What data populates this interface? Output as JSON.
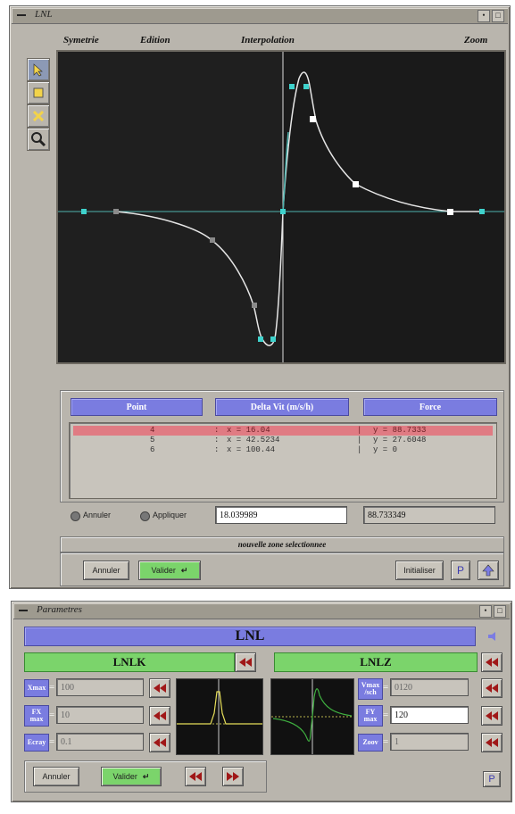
{
  "lnl_window": {
    "title": "LNL",
    "menu": [
      "Symetrie",
      "Edition",
      "Interpolation",
      "Zoom"
    ],
    "tools": [
      "pointer-icon",
      "add-point-icon",
      "delete-point-icon",
      "magnifier-icon"
    ],
    "table": {
      "headers": [
        "Point",
        "Delta Vit (m/s/h)",
        "Force"
      ],
      "rows": [
        {
          "point": "4",
          "x": "x = 16.04",
          "y": "y = 88.7333",
          "selected": true
        },
        {
          "point": "5",
          "x": "x = 42.5234",
          "y": "y = 27.6048",
          "selected": false
        },
        {
          "point": "6",
          "x": "x = 100.44",
          "y": "y = 0",
          "selected": false
        }
      ],
      "separator": ":",
      "separator2": "|"
    },
    "radio_annuler": "Annuler",
    "radio_appliquer": "Appliquer",
    "x_value": "18.039989",
    "y_value": "88.733349",
    "status": "nouvelle zone selectionnee",
    "btn_annuler": "Annuler",
    "btn_valider": "Valider",
    "btn_initialiser": "Initialiser",
    "btn_p": "P",
    "colors": {
      "curve": "#e6e6e6",
      "axis": "#4fb3ae",
      "point_cyan": "#3fd2cc",
      "point_white": "#ffffff",
      "point_gray": "#8a8a8a"
    }
  },
  "param_window": {
    "title": "Parametres",
    "main_title": "LNL",
    "left": {
      "title": "LNLK",
      "fields": [
        {
          "label": "Xmax",
          "value": "100"
        },
        {
          "label": "FX max",
          "value": "10"
        },
        {
          "label": "Ecray",
          "value": "0.1"
        }
      ]
    },
    "right": {
      "title": "LNLZ",
      "fields": [
        {
          "label": "Vmax /sch",
          "value": "0120"
        },
        {
          "label": "FY max",
          "value": "120"
        },
        {
          "label": "Zoov",
          "value": "1"
        }
      ]
    },
    "eq": "=",
    "btn_annuler": "Annuler",
    "btn_valider": "Valider",
    "btn_p": "P"
  }
}
